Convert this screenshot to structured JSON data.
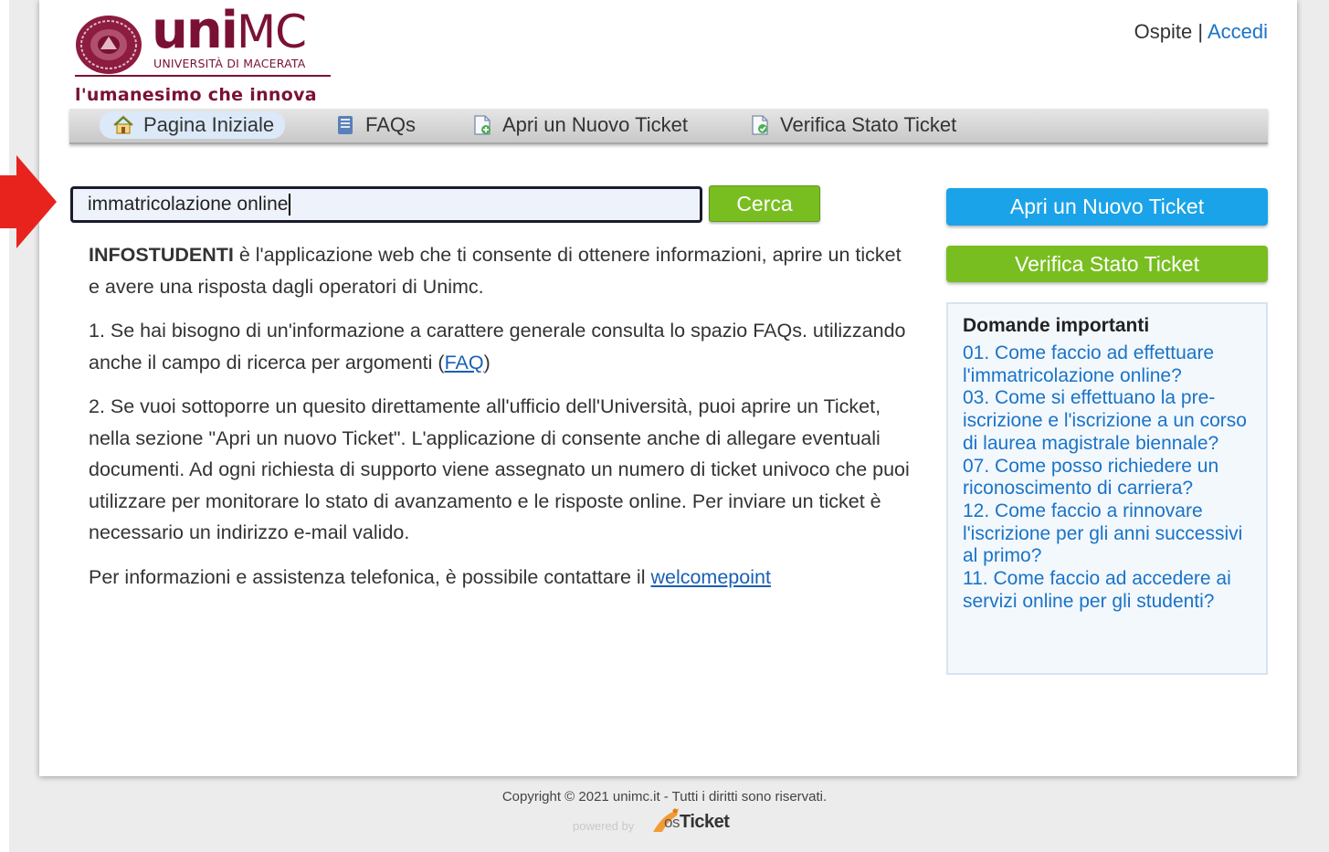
{
  "logo": {
    "word_bold": "uni",
    "word_thin": "MC",
    "subtitle": "UNIVERSITÀ DI MACERATA",
    "tagline": "l'umanesimo che innova"
  },
  "user": {
    "guest": "Ospite",
    "separator": "|",
    "login": "Accedi"
  },
  "nav": {
    "items": [
      {
        "label": "Pagina Iniziale",
        "icon": "home-icon",
        "active": true
      },
      {
        "label": "FAQs",
        "icon": "book-icon",
        "active": false
      },
      {
        "label": "Apri un Nuovo Ticket",
        "icon": "new-ticket-icon",
        "active": false
      },
      {
        "label": "Verifica Stato Ticket",
        "icon": "ticket-status-icon",
        "active": false
      }
    ]
  },
  "search": {
    "value": "immatricolazione online",
    "button": "Cerca"
  },
  "main": {
    "intro_strong": "INFOSTUDENTI",
    "intro_rest": " è l'applicazione web che ti consente di ottenere informazioni, aprire un ticket e avere una risposta dagli operatori di Unimc.",
    "p1_text": "1. Se hai bisogno di un'informazione a carattere generale consulta lo spazio FAQs. utilizzando anche il campo di ricerca per argomenti (",
    "p1_link": "FAQ",
    "p1_end": ")",
    "p2": "2. Se vuoi sottoporre un quesito direttamente all'ufficio dell'Università, puoi aprire un Ticket, nella sezione \"Apri un nuovo Ticket\". L'applicazione di consente anche di allegare eventuali documenti. Ad ogni richiesta di supporto viene assegnato un numero di ticket univoco che puoi utilizzare per monitorare lo stato di avanzamento e le risposte online. Per inviare un ticket è necessario un indirizzo e-mail valido.",
    "p3_text": "Per informazioni e assistenza telefonica, è possibile contattare il ",
    "p3_link": "welcomepoint"
  },
  "sidebar": {
    "new_ticket": "Apri un Nuovo Ticket",
    "check_ticket": "Verifica Stato Ticket",
    "faq_title": "Domande importanti",
    "faqs": [
      "01. Come faccio ad effettuare l'immatricolazione online?",
      "03. Come si effettuano la pre-iscrizione e l'iscrizione a un corso di laurea magistrale biennale?",
      "07. Come posso richiedere un riconoscimento di carriera?",
      "12. Come faccio a rinnovare l'iscrizione per gli anni successivi al primo?",
      "11. Come faccio ad accedere ai servizi online per gli studenti?"
    ]
  },
  "footer": {
    "copyright": "Copyright © 2021 unimc.it - Tutti i diritti sono riservati.",
    "powered_by": "powered by",
    "brand_os": "os",
    "brand_ticket": "Ticket"
  },
  "colors": {
    "brand": "#7a1135",
    "link": "#1a73c7",
    "green": "#78be20",
    "blue_button": "#1aa3e8",
    "arrow": "#e8231e"
  }
}
